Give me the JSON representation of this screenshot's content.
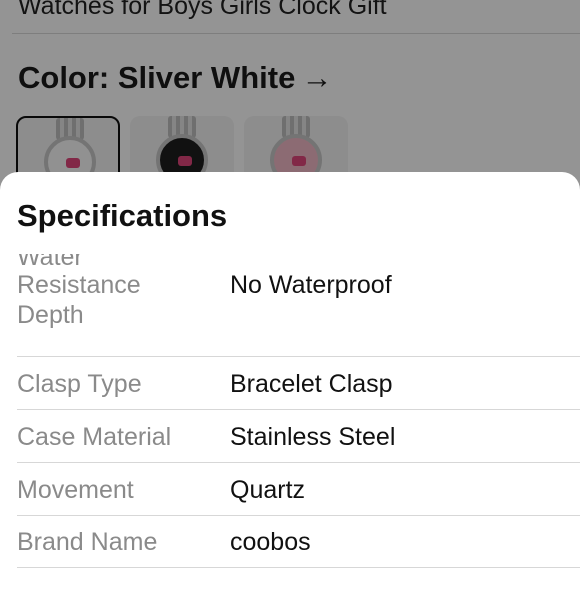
{
  "background": {
    "product_title": "Watches for Boys Girls Clock Gift",
    "color_label": "Color: Sliver White",
    "color_arrow": "→",
    "swatches": [
      {
        "name": "white-hello-kitty",
        "selected": true
      },
      {
        "name": "black-hello-kitty",
        "selected": false
      },
      {
        "name": "pink-hello-kitty",
        "selected": false
      }
    ]
  },
  "sheet": {
    "title": "Specifications",
    "rows": [
      {
        "label_l1": "Water",
        "label_l2": "Resistance",
        "label_l3": "Depth",
        "value": "No Waterproof"
      },
      {
        "label": "Clasp Type",
        "value": "Bracelet Clasp"
      },
      {
        "label": "Case Material",
        "value": "Stainless Steel"
      },
      {
        "label": "Movement",
        "value": "Quartz"
      },
      {
        "label": "Brand Name",
        "value": "coobos"
      }
    ]
  }
}
